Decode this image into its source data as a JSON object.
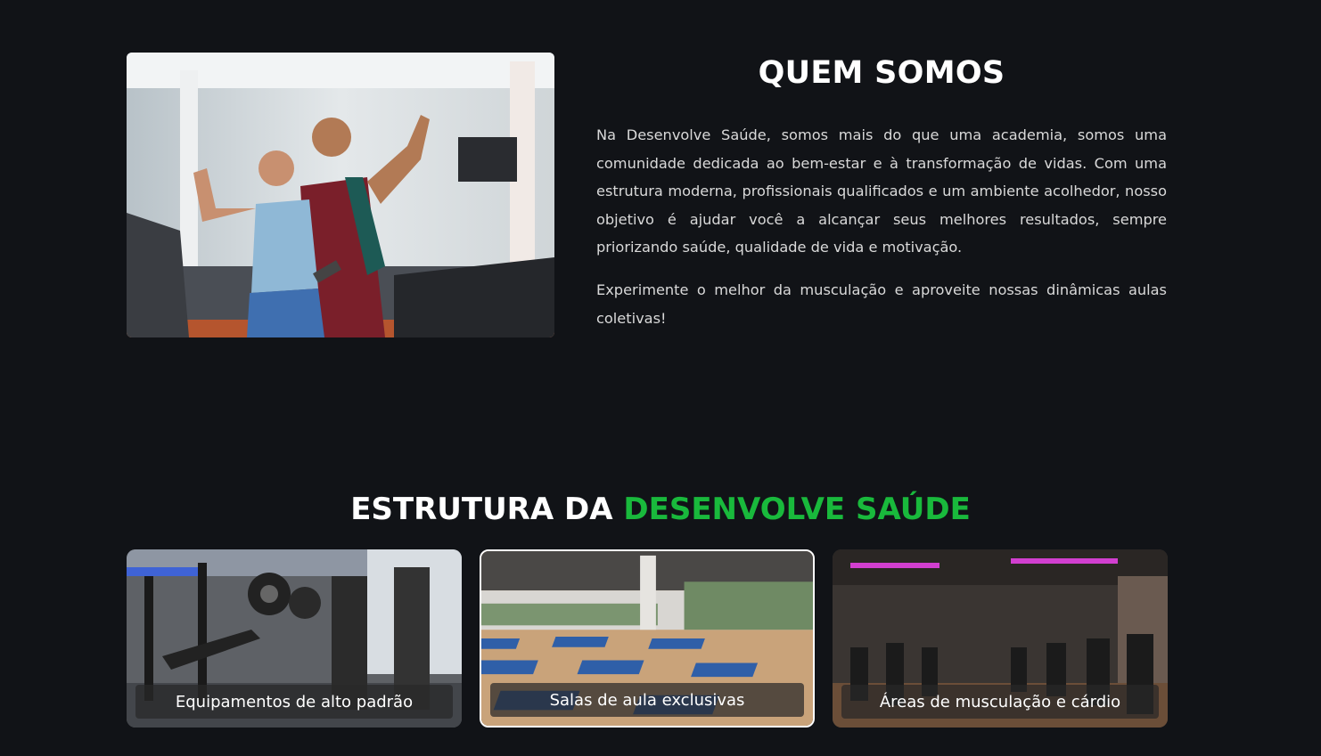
{
  "about": {
    "title": "QUEM SOMOS",
    "paragraphs": [
      "Na Desenvolve Saúde, somos mais do que uma academia, somos uma comunidade dedicada ao bem-estar e à transformação de vidas. Com uma estrutura moderna, profissionais qualificados e um ambiente acolhedor, nosso objetivo é ajudar você a alcançar seus melhores resultados, sempre priorizando saúde, qualidade de vida e motivação.",
      "Experimente o melhor da musculação e aproveite nossas dinâmicas aulas coletivas!"
    ]
  },
  "structure": {
    "title_prefix": "ESTRUTURA DA ",
    "title_accent": "DESENVOLVE SAÚDE",
    "accent_color": "#19b93c",
    "cards": [
      {
        "label": "Equipamentos de alto padrão"
      },
      {
        "label": "Salas de aula exclusivas"
      },
      {
        "label": "Áreas de musculação e cárdio"
      }
    ]
  },
  "colors": {
    "background": "#111317",
    "heading": "#ffffff",
    "body_text": "#d9d9d9"
  }
}
